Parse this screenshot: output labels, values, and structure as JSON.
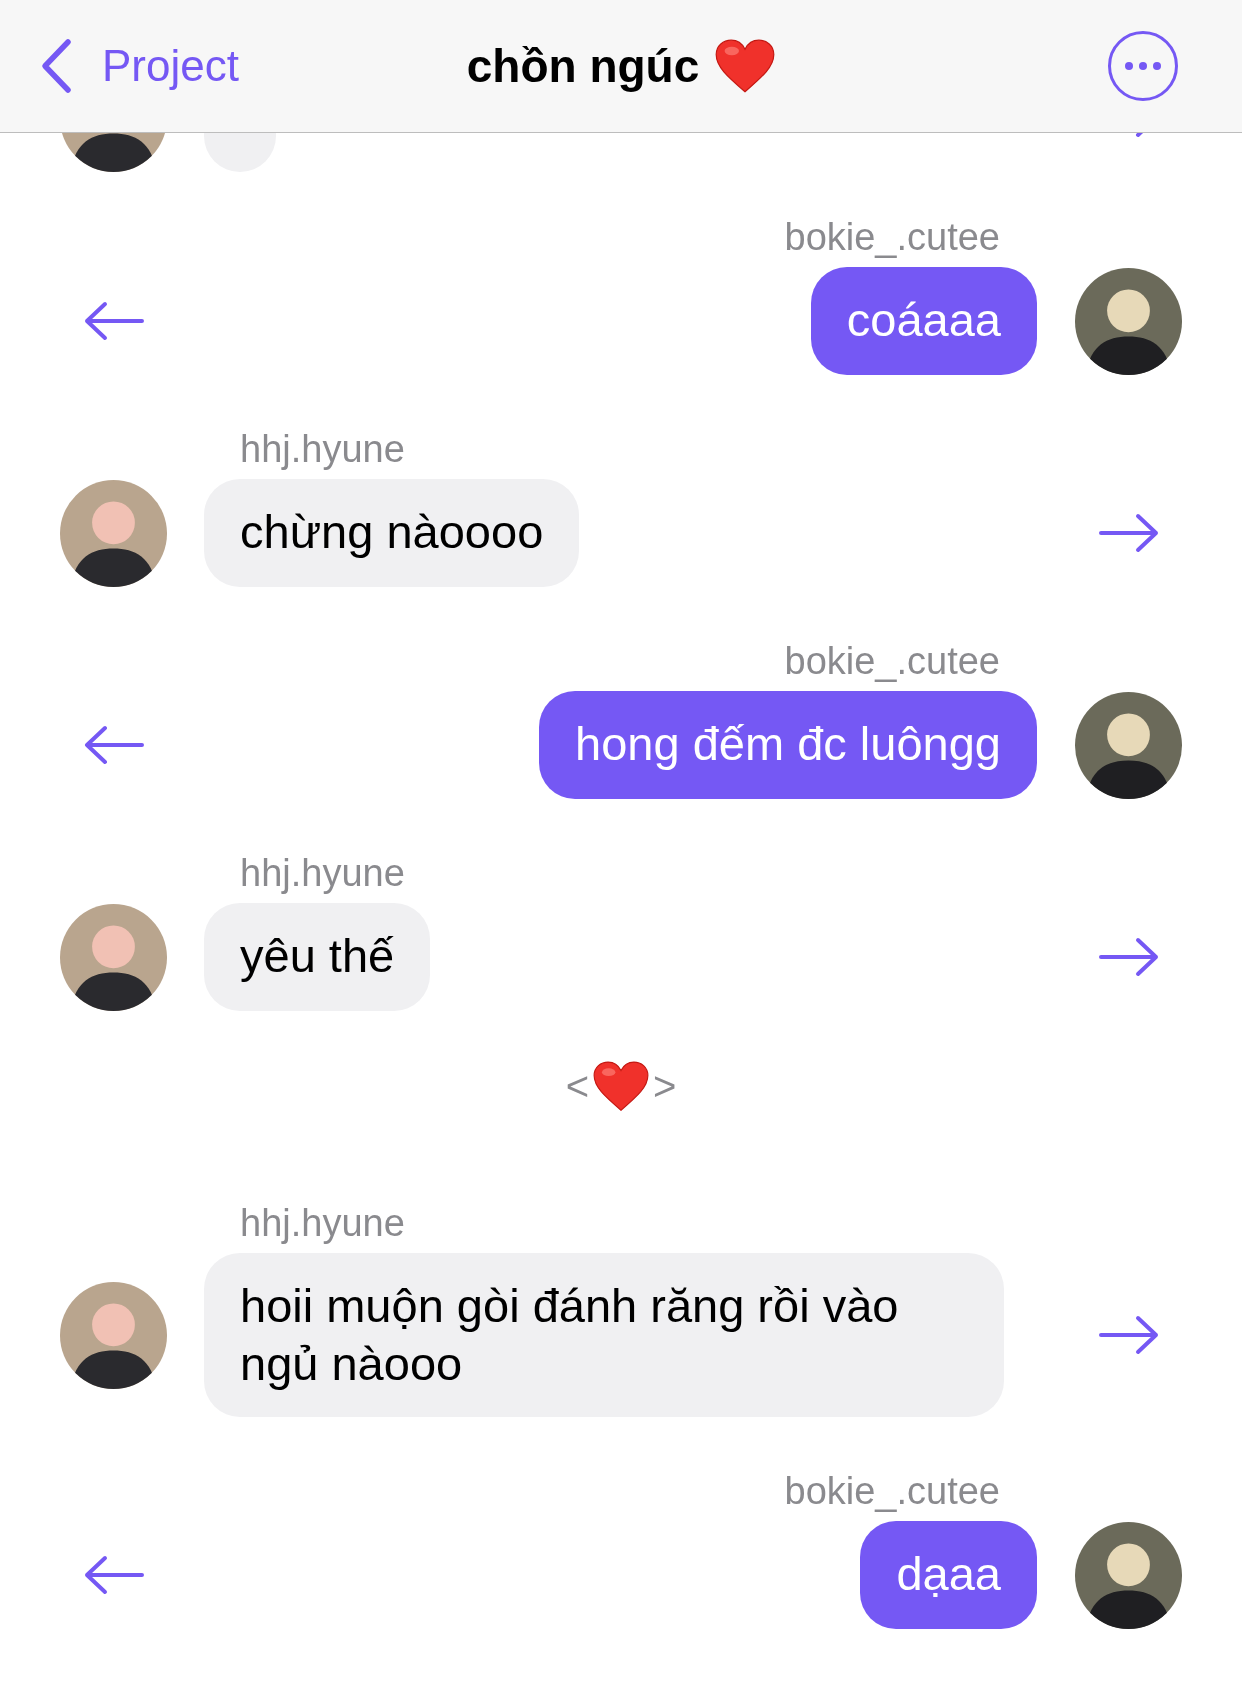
{
  "header": {
    "back_label": "Project",
    "title": "chồn ngúc"
  },
  "messages": [
    {
      "kind": "incoming",
      "partial": true
    },
    {
      "kind": "outgoing",
      "user": "bokie_.cutee",
      "text": "coáaaa"
    },
    {
      "kind": "incoming",
      "user": "hhj.hyune",
      "text": "chừng nàoooo"
    },
    {
      "kind": "outgoing",
      "user": "bokie_.cutee",
      "text": "hong đếm đc luôngg"
    },
    {
      "kind": "incoming",
      "user": "hhj.hyune",
      "text": "yêu thế"
    },
    {
      "kind": "divider",
      "left": "<",
      "right": ">"
    },
    {
      "kind": "incoming",
      "user": "hhj.hyune",
      "text": "hoii muộn gòi đánh răng rồi vào ngủ nàooo"
    },
    {
      "kind": "outgoing",
      "user": "bokie_.cutee",
      "text": "dạaa"
    }
  ]
}
